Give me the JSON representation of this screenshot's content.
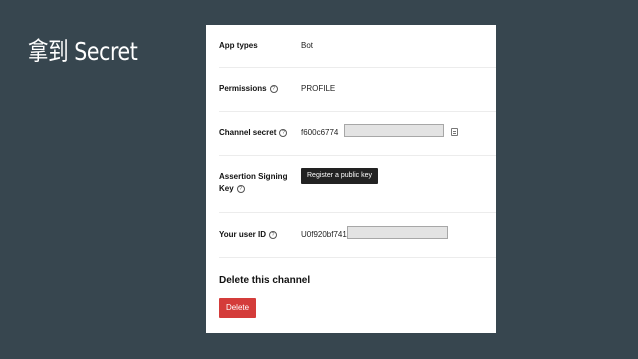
{
  "slide": {
    "title": "拿到 Secret"
  },
  "settings": {
    "app_types": {
      "label": "App types",
      "value": "Bot"
    },
    "permissions": {
      "label": "Permissions",
      "value": "PROFILE"
    },
    "channel_secret": {
      "label": "Channel secret",
      "value": "f600c6774"
    },
    "assertion_signing_key": {
      "label_line1": "Assertion Signing",
      "label_line2": "Key",
      "button_label": "Register a public key"
    },
    "user_id": {
      "label": "Your user ID",
      "value": "U0f920bf741"
    },
    "help_icon_glyph": "?"
  },
  "danger_zone": {
    "heading": "Delete this channel",
    "delete_label": "Delete",
    "delete_color": "#d43c3a"
  },
  "colors": {
    "background": "#37464f",
    "panel": "#ffffff"
  }
}
